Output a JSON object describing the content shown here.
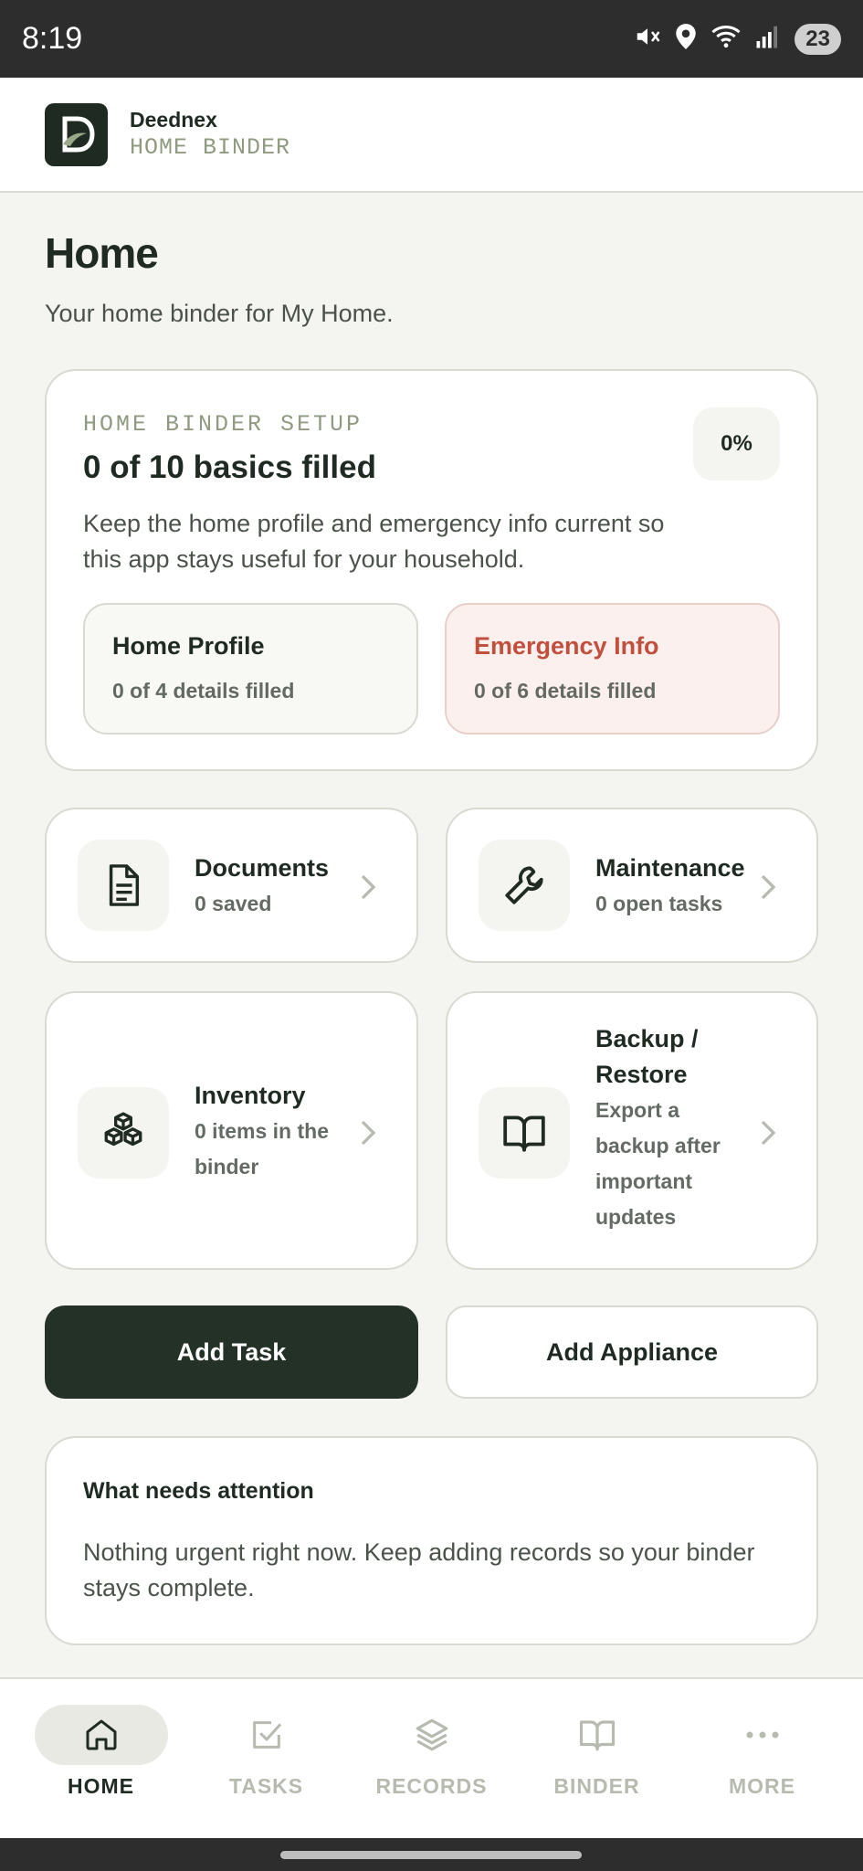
{
  "status_bar": {
    "time": "8:19",
    "battery": "23",
    "icons": [
      "mute-icon",
      "location-icon",
      "wifi-icon",
      "signal-icon",
      "battery-icon"
    ]
  },
  "app_bar": {
    "brand_name": "Deednex",
    "brand_sub": "HOME BINDER"
  },
  "page": {
    "title": "Home",
    "subtitle": "Your home binder for My Home."
  },
  "setup": {
    "eyebrow": "HOME BINDER SETUP",
    "headline": "0 of 10 basics filled",
    "description": "Keep the home profile and emergency info current so this app stays useful for your household.",
    "percent": "0%",
    "percent_value": 0,
    "home_profile": {
      "title": "Home Profile",
      "status": "0 of 4 details filled"
    },
    "emergency_info": {
      "title": "Emergency Info",
      "status": "0 of 6 details filled"
    }
  },
  "tiles": {
    "documents": {
      "title": "Documents",
      "subtitle": "0 saved",
      "icon": "document-icon"
    },
    "maintenance": {
      "title": "Maintenance",
      "subtitle": "0 open tasks",
      "icon": "wrench-icon"
    },
    "inventory": {
      "title": "Inventory",
      "subtitle": "0 items in the binder",
      "icon": "boxes-icon"
    },
    "backup": {
      "title": "Backup / Restore",
      "subtitle": "Export a backup after important updates",
      "icon": "book-icon"
    }
  },
  "actions": {
    "add_task": "Add Task",
    "add_appliance": "Add Appliance"
  },
  "attention": {
    "title": "What needs attention",
    "description": "Nothing urgent right now. Keep adding records so your binder stays complete."
  },
  "bottom_nav": [
    {
      "label": "HOME",
      "icon": "home-icon",
      "active": true
    },
    {
      "label": "TASKS",
      "icon": "checkbox-icon",
      "active": false
    },
    {
      "label": "RECORDS",
      "icon": "layers-icon",
      "active": false
    },
    {
      "label": "BINDER",
      "icon": "book-icon",
      "active": false
    },
    {
      "label": "MORE",
      "icon": "more-icon",
      "active": false
    }
  ],
  "colors": {
    "primary_dark": "#233127",
    "accent_red": "#c0503d",
    "muted_green": "#8f9a80",
    "background": "#f4f4f0"
  }
}
